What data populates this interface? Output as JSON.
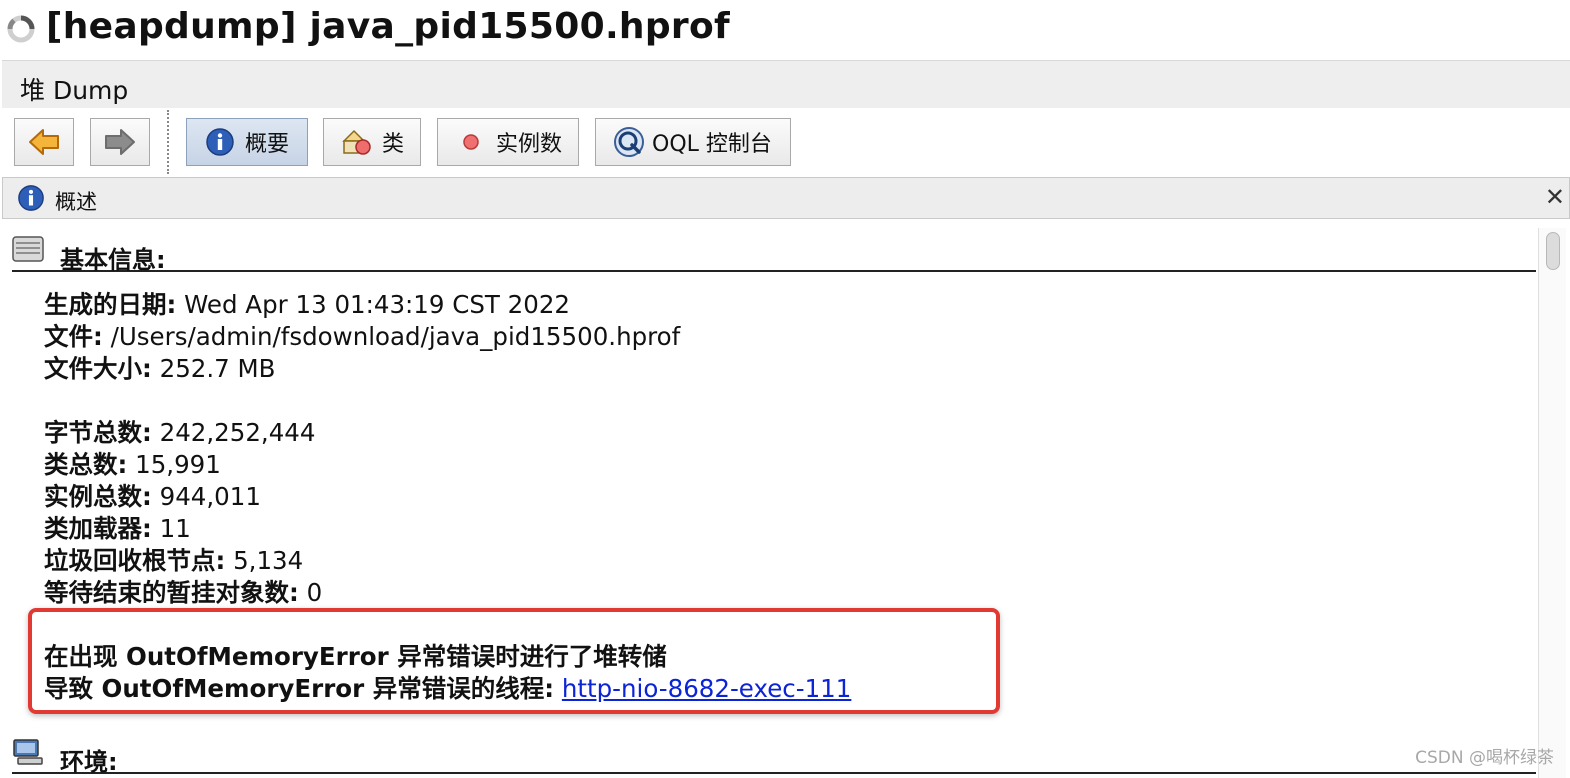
{
  "window": {
    "title": "[heapdump] java_pid15500.hprof",
    "menu_label": "堆 Dump"
  },
  "toolbar": {
    "back_icon": "arrow-left-icon",
    "forward_icon": "arrow-right-icon",
    "buttons": [
      {
        "label": "概要",
        "icon": "info-icon",
        "active": true
      },
      {
        "label": "类",
        "icon": "classes-icon",
        "active": false
      },
      {
        "label": "实例数",
        "icon": "instances-icon",
        "active": false
      },
      {
        "label": "OQL 控制台",
        "icon": "oql-icon",
        "active": false
      }
    ]
  },
  "tab": {
    "label": "概述",
    "icon": "info-icon",
    "close_label": "✕"
  },
  "basic_info": {
    "heading": "基本信息:",
    "date_label": "生成的日期:",
    "date_value": " Wed Apr 13 01:43:19 CST 2022",
    "file_label": "文件:",
    "file_value": " /Users/admin/fsdownload/java_pid15500.hprof",
    "size_label": "文件大小:",
    "size_value": " 252.7 MB",
    "bytes_label": "字节总数:",
    "bytes_value": " 242,252,444",
    "classes_label": "类总数:",
    "classes_value": " 15,991",
    "instances_label": "实例总数:",
    "instances_value": " 944,011",
    "loaders_label": "类加载器:",
    "loaders_value": " 11",
    "gc_roots_label": "垃圾回收根节点:",
    "gc_roots_value": " 5,134",
    "finalize_label": "等待结束的暂挂对象数:",
    "finalize_value": " 0",
    "oom_line": "在出现 OutOfMemoryError 异常错误时进行了堆转储",
    "oom_thread_label": "导致 OutOfMemoryError 异常错误的线程:",
    "oom_thread_link": "http-nio-8682-exec-111"
  },
  "environment": {
    "heading": "环境:"
  },
  "watermark": "CSDN @喝杯绿茶",
  "colors": {
    "highlight_box": "#e03a33",
    "link": "#0b24d6",
    "active_button": "#c7d4e6"
  }
}
